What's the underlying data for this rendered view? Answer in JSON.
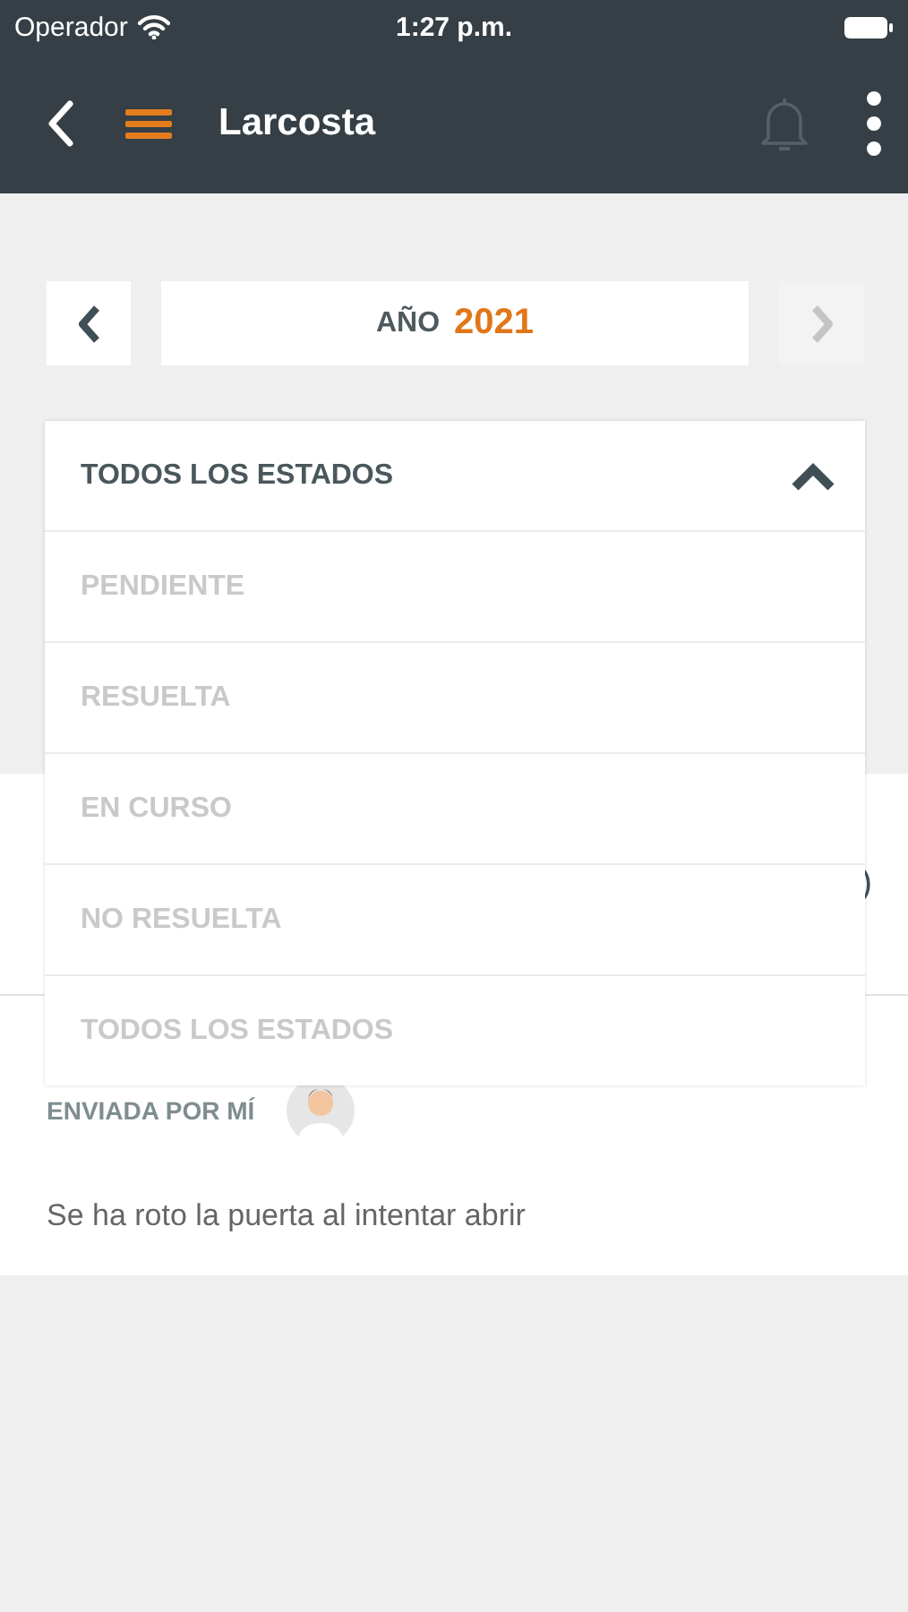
{
  "status_bar": {
    "carrier": "Operador",
    "time": "1:27 p.m."
  },
  "nav_bar": {
    "title": "Larcosta"
  },
  "year_picker": {
    "label": "AÑO",
    "year": "2021",
    "previous_disabled": false,
    "next_disabled": true
  },
  "state_filter": {
    "value": "TODOS LOS ESTADOS",
    "expanded": true,
    "options": [
      {
        "label": "PENDIENTE"
      },
      {
        "label": "RESUELTA"
      },
      {
        "label": "EN CURSO"
      },
      {
        "label": "NO RESUELTA"
      },
      {
        "label": "TODOS LOS ESTADOS"
      }
    ]
  },
  "request_card": {
    "partial_text": ")",
    "sender": "ENVIADA POR MÍ",
    "description": "Se ha roto la puerta al intentar abrir"
  }
}
